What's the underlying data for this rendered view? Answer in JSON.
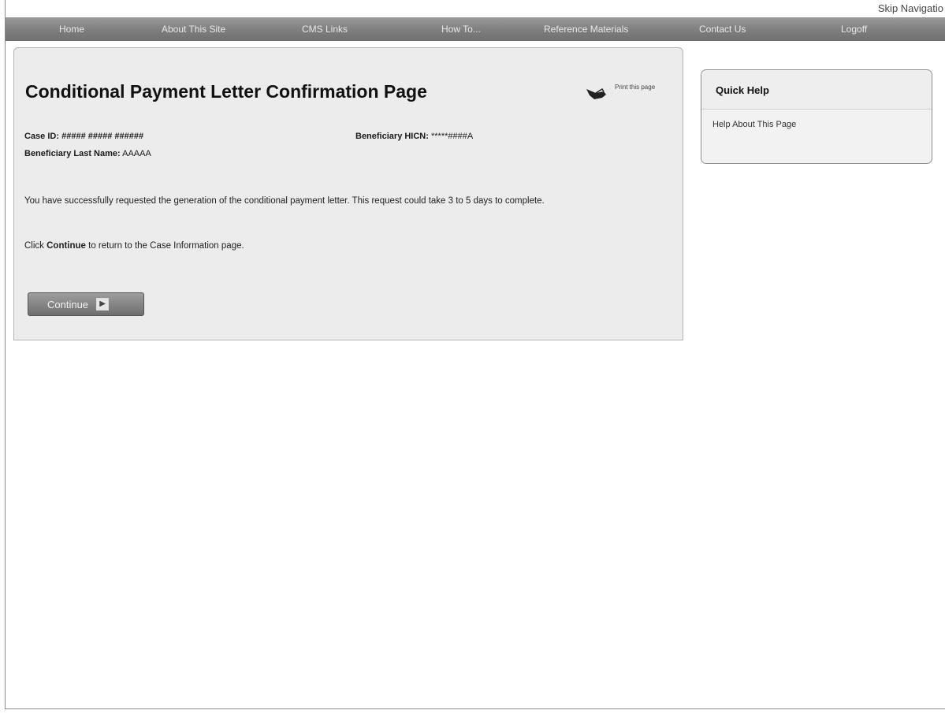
{
  "header": {
    "skip_navigation": "Skip Navigatio"
  },
  "nav": {
    "items": [
      "Home",
      "About This Site",
      "CMS Links",
      "How To...",
      "Reference Materials",
      "Contact Us",
      "Logoff"
    ]
  },
  "page": {
    "title": "Conditional Payment Letter Confirmation Page",
    "print_link": "Print this page",
    "case_id_label": "Case ID:",
    "case_id_value": "##### ##### ######",
    "hicn_label": "Beneficiary HICN:",
    "hicn_value": "*****####A",
    "last_name_label": "Beneficiary Last Name:",
    "last_name_value": "AAAAA",
    "message": "You have successfully requested the generation of the conditional payment letter. This request could take 3 to 5 days to complete.",
    "instruction_prefix": "Click ",
    "instruction_bold": "Continue",
    "instruction_suffix": " to return to the Case Information page.",
    "continue_label": "Continue"
  },
  "quick_help": {
    "title": "Quick Help",
    "link": "Help About This Page"
  },
  "icons": {
    "print": "hand-pointer-icon",
    "continue_arrow": "arrow-right-icon"
  }
}
